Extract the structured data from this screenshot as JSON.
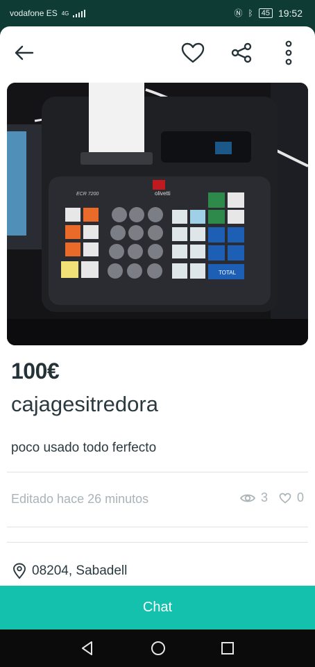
{
  "status_bar": {
    "carrier": "vodafone ES",
    "network": "4G",
    "battery": "45",
    "time": "19:52"
  },
  "listing": {
    "price": "100€",
    "title": "cajagesitredora",
    "description": "poco usado todo ferfecto",
    "edited": "Editado hace 26 minutos",
    "views": "3",
    "favorites": "0",
    "location": "08204, Sabadell"
  },
  "actions": {
    "chat_label": "Chat"
  },
  "photo": {
    "brand": "olivetti",
    "model": "ECR 7200",
    "total_key": "TOTAL"
  },
  "colors": {
    "accent": "#13c1ac",
    "status_bg": "#0f3b35",
    "nav_bg": "#0b0b0b"
  },
  "icons": [
    "back-arrow-icon",
    "heart-icon",
    "share-icon",
    "more-vertical-icon",
    "eye-icon",
    "small-heart-icon",
    "location-pin-icon",
    "nav-back-icon",
    "nav-home-icon",
    "nav-recents-icon"
  ]
}
